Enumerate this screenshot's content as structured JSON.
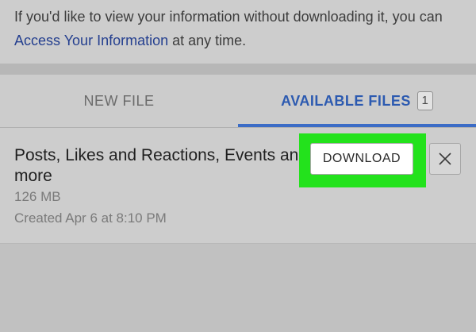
{
  "intro": {
    "text_before_link": "If you'd like to view your information without downloading it, you can ",
    "link_text": "Access Your Information",
    "text_after_link": " at any time."
  },
  "tabs": {
    "new_file_label": "NEW FILE",
    "available_files_label": "AVAILABLE FILES",
    "available_files_count": "1"
  },
  "file": {
    "title": "Posts, Likes and Reactions, Events and more",
    "size": "126 MB",
    "created": "Created Apr 6 at 8:10 PM",
    "download_label": "DOWNLOAD",
    "delete_icon": "close-icon"
  },
  "colors": {
    "link": "#243f8f",
    "active_tab": "#2c5ab0",
    "highlight": "#23e21c"
  }
}
